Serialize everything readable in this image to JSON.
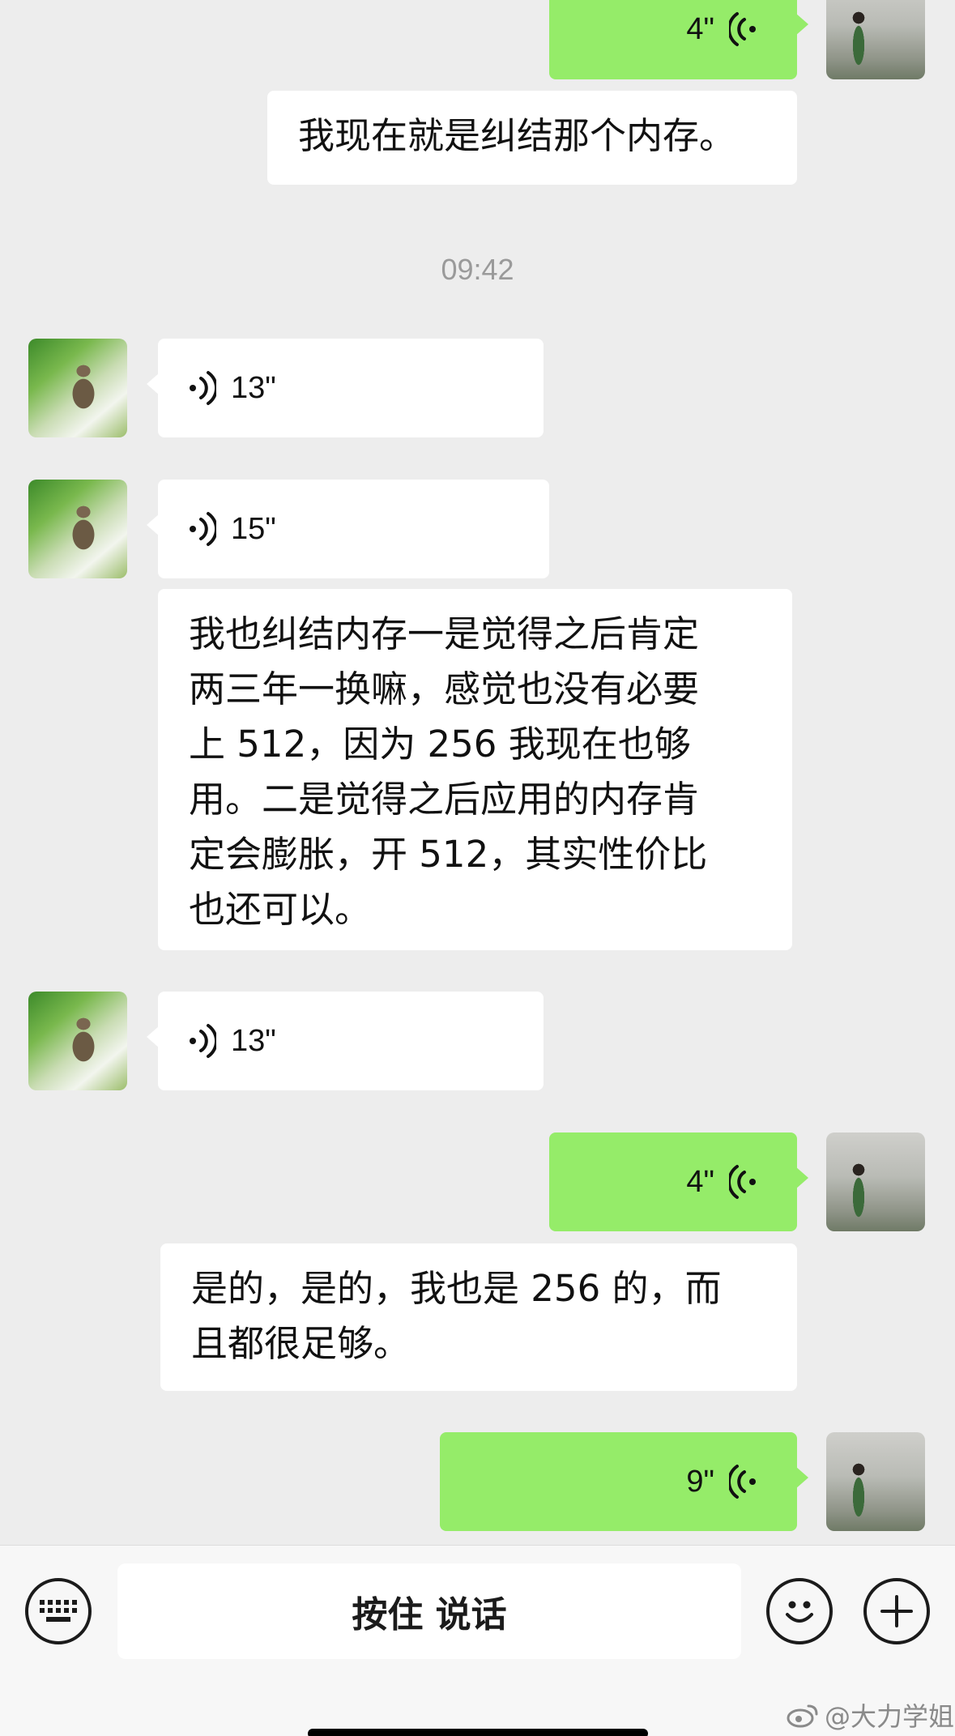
{
  "timestamp": "09:42",
  "messages": [
    {
      "side": "right",
      "type": "voice",
      "duration": "4\""
    },
    {
      "side": "right",
      "type": "text",
      "text": "我现在就是纠结那个内存。"
    },
    {
      "side": "left",
      "type": "voice",
      "duration": "13\""
    },
    {
      "side": "left",
      "type": "voice",
      "duration": "15\""
    },
    {
      "side": "left",
      "type": "text",
      "lines": [
        "我也纠结内存一是觉得之后肯定",
        "两三年一换嘛，感觉也没有必要",
        "上 512，因为 256 我现在也够",
        "用。二是觉得之后应用的内存肯",
        "定会膨胀，开 512，其实性价比",
        "也还可以。"
      ]
    },
    {
      "side": "left",
      "type": "voice",
      "duration": "13\""
    },
    {
      "side": "right",
      "type": "voice",
      "duration": "4\""
    },
    {
      "side": "right",
      "type": "text",
      "lines": [
        "是的，是的，我也是 256 的，而",
        "且都很足够。"
      ]
    },
    {
      "side": "right",
      "type": "voice",
      "duration": "9\""
    }
  ],
  "input_bar": {
    "hold_to_talk_label": "按住 说话"
  },
  "watermark": "@大力学姐",
  "icons": {
    "voice_left": "voice-wave-icon",
    "voice_right": "voice-wave-icon",
    "keyboard": "keyboard-icon",
    "emoji": "emoji-icon",
    "plus": "plus-icon",
    "weibo": "weibo-icon"
  },
  "colors": {
    "background": "#ededed",
    "green_bubble": "#95ec69",
    "white_bubble": "#ffffff"
  }
}
